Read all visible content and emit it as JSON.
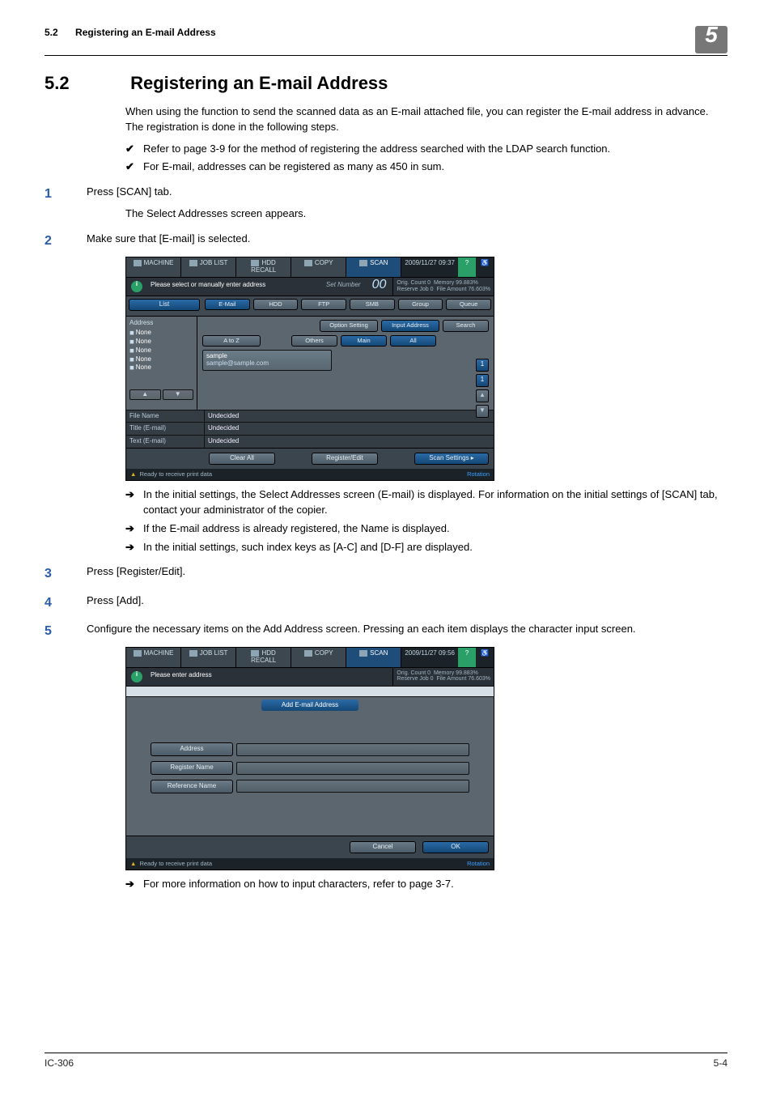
{
  "header": {
    "section_number": "5.2",
    "section_title": "Registering an E-mail Address",
    "chapter_badge": "5"
  },
  "title": {
    "number": "5.2",
    "text": "Registering an E-mail Address"
  },
  "intro": "When using the function to send the scanned data as an E-mail attached file, you can register the E-mail address in advance. The registration is done in the following steps.",
  "checks": [
    "Refer to page 3-9 for the method of registering the address searched with the LDAP search function.",
    "For E-mail, addresses can be registered as many as 450 in sum."
  ],
  "steps": {
    "s1": {
      "num": "1",
      "text": "Press [SCAN] tab.",
      "sub": "The Select Addresses screen appears."
    },
    "s2": {
      "num": "2",
      "text": "Make sure that [E-mail] is selected."
    },
    "s2_notes": [
      "In the initial settings, the Select Addresses screen (E-mail) is displayed.  For information on the initial settings of [SCAN] tab, contact your administrator of the copier.",
      "If the E-mail address is already registered, the Name is displayed.",
      "In the initial settings, such index keys as [A-C] and [D-F] are displayed."
    ],
    "s3": {
      "num": "3",
      "text": "Press [Register/Edit]."
    },
    "s4": {
      "num": "4",
      "text": "Press [Add]."
    },
    "s5": {
      "num": "5",
      "text": "Configure the necessary items on the Add Address screen.  Pressing an each item displays the character input screen."
    },
    "s5_notes": [
      "For more information on how to input characters, refer to page 3-7."
    ]
  },
  "screenshot1": {
    "tabs": {
      "machine": "MACHINE",
      "joblist": "JOB LIST",
      "hdd": "HDD RECALL",
      "copy": "COPY",
      "scan": "SCAN"
    },
    "datetime": "2009/11/27 09:37",
    "message": "Please select or manually enter address",
    "set_number_label": "Set Number",
    "set_number_value": "00",
    "status": {
      "orig_count_l": "Orig. Count",
      "orig_count_v": "0",
      "reserve_l": "Reserve Job",
      "reserve_v": "0",
      "memory_l": "Memory",
      "memory_v": "99.883%",
      "file_l": "File Amount",
      "file_v": "76.603%"
    },
    "left_cat": "List",
    "cats": {
      "email": "E-Mail",
      "hdd": "HDD",
      "ftp": "FTP",
      "smb": "SMB",
      "group": "Group",
      "queue": "Queue"
    },
    "opts": {
      "option": "Option Setting",
      "input": "Input Address",
      "search": "Search"
    },
    "idx": {
      "atoz": "A to Z",
      "others": "Others",
      "main": "Main",
      "all": "All"
    },
    "addr_label": "Address",
    "none": "None",
    "sample_name": "sample",
    "sample_email": "sample@sample.com",
    "info": {
      "file_k": "File Name",
      "file_v": "Undecided",
      "title_k": "Title (E-mail)",
      "title_v": "Undecided",
      "text_k": "Text (E-mail)",
      "text_v": "Undecided"
    },
    "foot": {
      "clear": "Clear All",
      "regedit": "Register/Edit",
      "scanset": "Scan Settings"
    },
    "footbar": {
      "status": "Ready to receive print data",
      "rotation": "Rotation"
    },
    "caret": "▸"
  },
  "screenshot2": {
    "message": "Please enter address",
    "datetime": "2009/11/27 09:56",
    "title": "Add E-mail Address",
    "fields": {
      "address": "Address",
      "regname": "Register Name",
      "refname": "Reference Name"
    },
    "foot": {
      "cancel": "Cancel",
      "ok": "OK"
    }
  },
  "footer": {
    "left": "IC-306",
    "right": "5-4"
  },
  "glyph": {
    "tri_warn": "▲"
  }
}
